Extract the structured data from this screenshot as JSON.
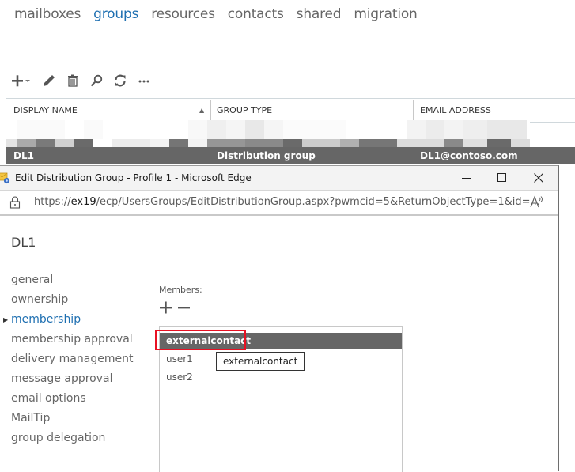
{
  "topnav": {
    "items": [
      {
        "label": "mailboxes",
        "active": false
      },
      {
        "label": "groups",
        "active": true
      },
      {
        "label": "resources",
        "active": false
      },
      {
        "label": "contacts",
        "active": false
      },
      {
        "label": "shared",
        "active": false
      },
      {
        "label": "migration",
        "active": false
      }
    ]
  },
  "toolbar": {
    "icons": [
      "add-dropdown-icon",
      "edit-pencil-icon",
      "delete-trash-icon",
      "search-icon",
      "refresh-icon",
      "more-ellipsis-icon"
    ]
  },
  "grid": {
    "columns": [
      "DISPLAY NAME",
      "GROUP TYPE",
      "EMAIL ADDRESS"
    ],
    "sort_indicator": "▲",
    "selected_row": {
      "display_name": "DL1",
      "group_type": "Distribution group",
      "email": "DL1@contoso.com"
    }
  },
  "window": {
    "title": "Edit Distribution Group - Profile 1 - Microsoft Edge",
    "url_prefix": "https://",
    "url_host": "ex19",
    "url_rest": "/ecp/UsersGroups/EditDistributionGroup.aspx?pwmcid=5&ReturnObjectType=1&id=...",
    "controls": {
      "minimize": "minimize",
      "maximize": "maximize",
      "close": "close"
    }
  },
  "editor": {
    "object_title": "DL1",
    "nav": [
      {
        "label": "general",
        "active": false
      },
      {
        "label": "ownership",
        "active": false
      },
      {
        "label": "membership",
        "active": true
      },
      {
        "label": "membership approval",
        "active": false
      },
      {
        "label": "delivery management",
        "active": false
      },
      {
        "label": "message approval",
        "active": false
      },
      {
        "label": "email options",
        "active": false
      },
      {
        "label": "MailTip",
        "active": false
      },
      {
        "label": "group delegation",
        "active": false
      }
    ],
    "members_label": "Members:",
    "members": [
      "externalcontact",
      "user1",
      "user2"
    ],
    "selected_member": "externalcontact",
    "tooltip": "externalcontact",
    "highlight_color": "#e81123"
  },
  "colors": {
    "accent": "#1e6fb1",
    "selected_row_bg": "#666666"
  }
}
